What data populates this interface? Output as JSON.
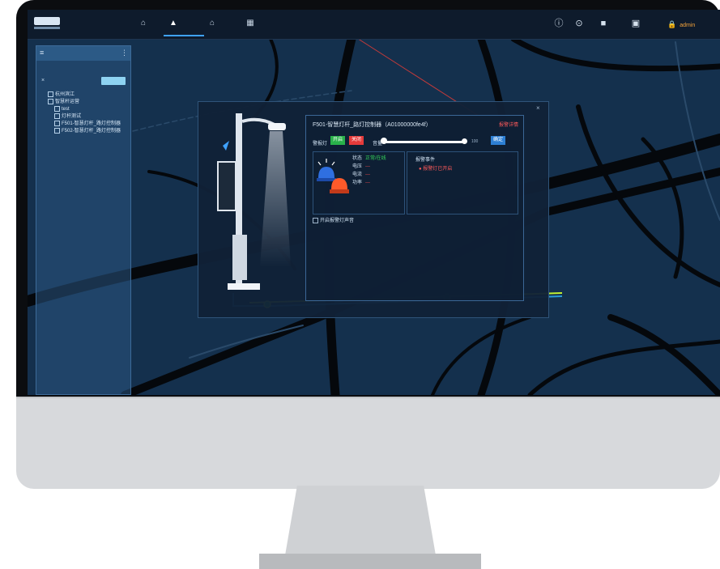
{
  "topbar": {
    "nav_icons": [
      "home-icon",
      "layers-icon",
      "building-icon",
      "grid-icon"
    ],
    "right_icons": [
      "info-icon",
      "location-pin-icon",
      "briefcase-icon",
      "monitor-icon"
    ],
    "user_icon": "lock-icon",
    "user_name": "admin"
  },
  "sidebar": {
    "search_button": "",
    "tree": [
      {
        "label": "杭州滨江",
        "level": 1
      },
      {
        "label": "智慧杆运营",
        "level": 1
      },
      {
        "label": "test",
        "level": 2
      },
      {
        "label": "灯杆测试",
        "level": 2
      },
      {
        "label": "F501-智慧灯杆_路灯控制器",
        "level": 2
      },
      {
        "label": "F502-智慧灯杆_路灯控制器",
        "level": 2
      }
    ]
  },
  "popup": {
    "title": "F501-智慧灯杆_路灯控制器（A01000000fe4f）",
    "link": "报警详情",
    "control_label": "警报灯",
    "on_label": "开启",
    "off_label": "关闭",
    "volume_label": "音量",
    "volume_max": "100",
    "confirm_label": "确定",
    "volume_level": 1.0,
    "status": [
      {
        "label": "状态",
        "value": "正常/在线",
        "color": "green"
      },
      {
        "label": "电压",
        "value": "---",
        "color": "red"
      },
      {
        "label": "电流",
        "value": "---",
        "color": "red"
      },
      {
        "label": "功率",
        "value": "---",
        "color": "red"
      }
    ],
    "events_title": "报警事件",
    "event_item": "● 报警灯已开启",
    "checkbox_label": "开启报警灯声音"
  },
  "colors": {
    "map_bg": "#14304d",
    "accent": "#3fa2ff",
    "on": "#29b14a",
    "off": "#e53b3b",
    "route": "#c3f231"
  }
}
